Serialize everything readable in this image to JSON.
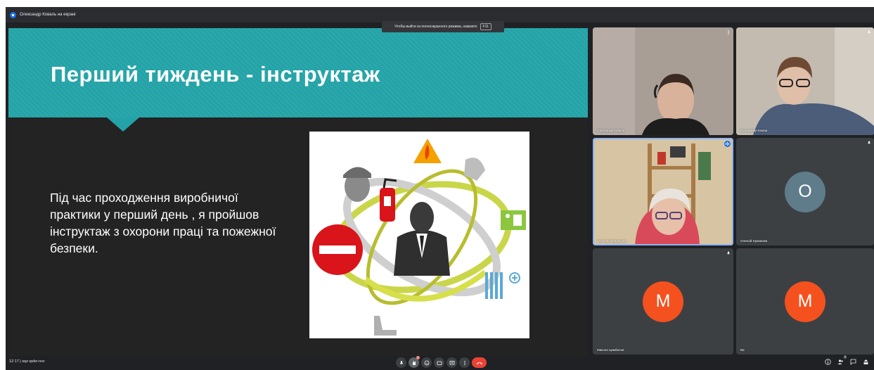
{
  "presenter": {
    "label": "Олександр Коваль на екрані"
  },
  "fullscreen_hint": {
    "text": "Чтобы выйти из полноэкранного режима, нажмите",
    "key": "F11"
  },
  "slide": {
    "title": "Перший тиждень - інструктаж",
    "body": "Під час проходження виробничої практики у перший день , я пройшов інструктаж з охорони праці та пожежної безпеки."
  },
  "participants": [
    {
      "name": "Олександр Коваль",
      "type": "video"
    },
    {
      "name": "Володимир Комар",
      "type": "video"
    },
    {
      "name": "Світлана Гридасова",
      "type": "video",
      "speaking": true
    },
    {
      "name": "Олексій Єрмакова",
      "type": "avatar",
      "initial": "O",
      "color": "#5f7c8a"
    },
    {
      "name": "Микола Цимбалов",
      "type": "avatar",
      "initial": "M",
      "color": "#f4511e"
    },
    {
      "name": "Ви",
      "type": "avatar",
      "initial": "M",
      "color": "#f4511e"
    }
  ],
  "meeting": {
    "time": "12:17",
    "code": "sqz-qvkn-nvv",
    "participant_count": "7"
  },
  "colors": {
    "banner": "#23a3a7",
    "end_call": "#ea4335",
    "avatar_orange": "#f4511e",
    "avatar_slate": "#5f7c8a"
  },
  "icons": [
    "presentation-icon",
    "mic-icon",
    "hand-raise-icon",
    "emoji-icon",
    "captions-icon",
    "present-screen-icon",
    "more-options-icon",
    "end-call-icon",
    "info-icon",
    "people-icon",
    "chat-icon",
    "activities-icon"
  ]
}
